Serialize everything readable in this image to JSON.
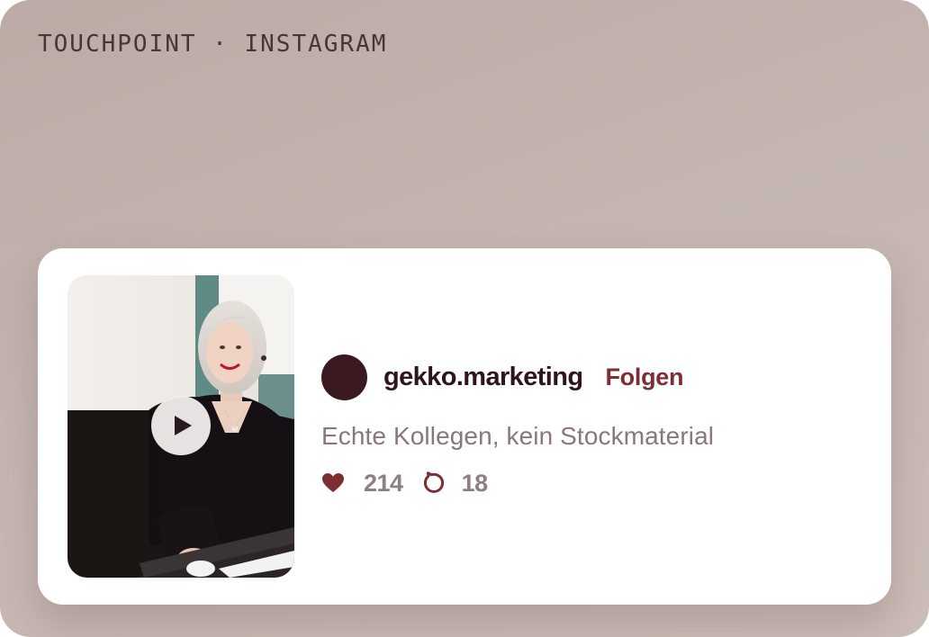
{
  "header": {
    "label": "TOUCHPOINT · INSTAGRAM"
  },
  "post": {
    "media_type": "video",
    "thumbnail_description_icon": "play-icon",
    "account": {
      "handle": "gekko.marketing",
      "follow_label": "Folgen"
    },
    "caption": "Echte Kollegen, kein Stockmaterial",
    "likes": "214",
    "comments": "18"
  },
  "colors": {
    "background": "#c4b5b0",
    "card": "#ffffff",
    "handle": "#2d1519",
    "accent": "#7d2e33",
    "muted_text": "#8a7778",
    "avatar": "#3a1a20"
  }
}
